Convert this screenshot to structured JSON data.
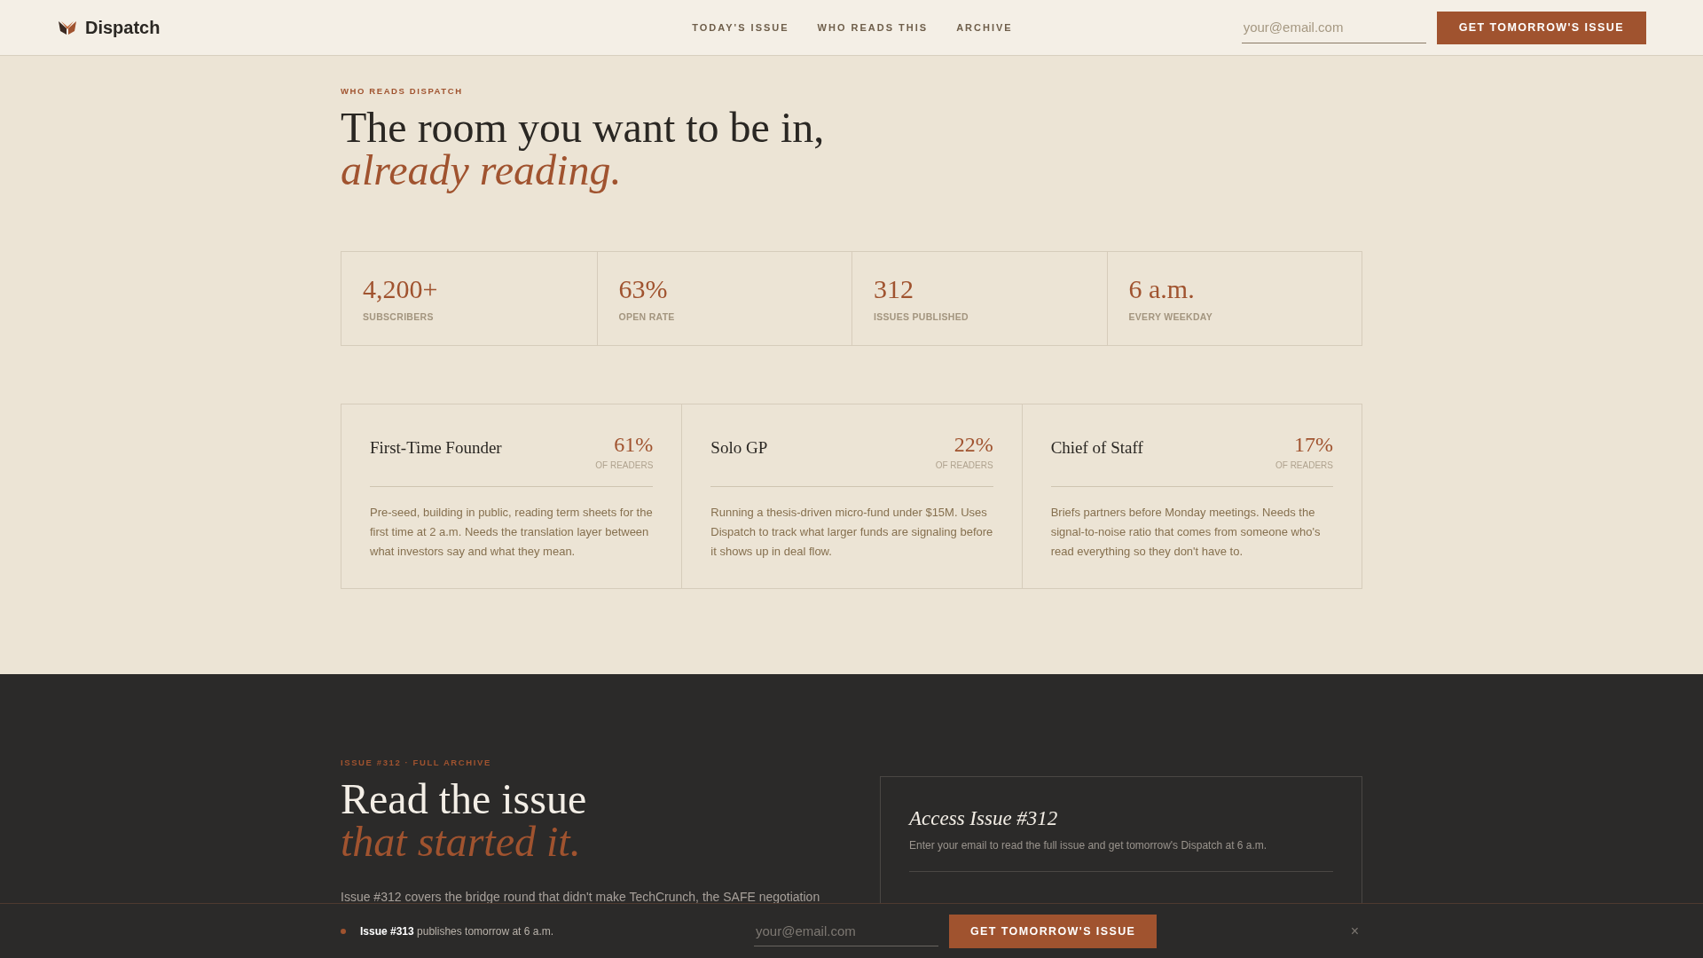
{
  "header": {
    "brand": "Dispatch",
    "nav": [
      {
        "label": "TODAY'S ISSUE"
      },
      {
        "label": "WHO READS THIS"
      },
      {
        "label": "ARCHIVE"
      }
    ],
    "email": {
      "placeholder": "your@email.com"
    },
    "button": "GET TOMORROW'S ISSUE"
  },
  "readers": {
    "eyebrow": "WHO READS DISPATCH",
    "title": "The room you want to be in,",
    "title_accent": "already reading.",
    "stats": [
      {
        "value": "4,200+",
        "label": "SUBSCRIBERS"
      },
      {
        "value": "63%",
        "label": "OPEN RATE"
      },
      {
        "value": "312",
        "label": "ISSUES PUBLISHED"
      },
      {
        "value": "6 a.m.",
        "label": "EVERY WEEKDAY"
      }
    ],
    "personas": [
      {
        "name": "First-Time Founder",
        "share": "61%",
        "share_label": "OF READERS",
        "description": "Pre-seed, building in public, reading term sheets for the first time at 2 a.m. Needs the translation layer between what investors say and what they mean."
      },
      {
        "name": "Solo GP",
        "share": "22%",
        "share_label": "OF READERS",
        "description": "Running a thesis-driven micro-fund under $15M. Uses Dispatch to track what larger funds are signaling before it shows up in deal flow."
      },
      {
        "name": "Chief of Staff",
        "share": "17%",
        "share_label": "OF READERS",
        "description": "Briefs partners before Monday meetings. Needs the signal-to-noise ratio that comes from someone who's read everything so they don't have to."
      }
    ]
  },
  "archive": {
    "eyebrow": "ISSUE #312 · FULL ARCHIVE",
    "title": "Read the issue",
    "title_accent": "that started it.",
    "intro": "Issue #312 covers the bridge round that didn't make TechCrunch, the SAFE negotiation",
    "access": {
      "title": "Access Issue #312",
      "text": "Enter your email to read the full issue and get tomorrow's Dispatch at 6 a.m."
    }
  },
  "sticky_bar": {
    "message": "**Issue #313** publishes tomorrow at 6 a.m.",
    "email": {
      "placeholder": "your@email.com"
    },
    "button": "GET TOMORROW'S ISSUE",
    "close": "×"
  }
}
